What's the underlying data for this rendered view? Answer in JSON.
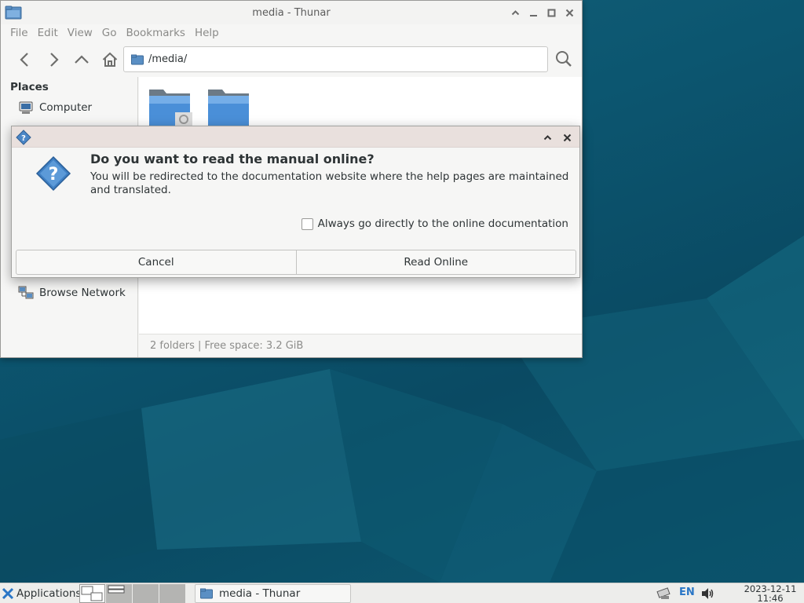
{
  "window": {
    "title": "media - Thunar",
    "menu": [
      "File",
      "Edit",
      "View",
      "Go",
      "Bookmarks",
      "Help"
    ],
    "location": "/media/",
    "sidebar": {
      "heading": "Places",
      "items": [
        {
          "label": "Computer",
          "icon": "computer-icon"
        },
        {
          "label": "Browse Network",
          "icon": "network-icon"
        }
      ]
    },
    "status": "2 folders  |  Free space: 3.2 GiB"
  },
  "dialog": {
    "heading": "Do you want to read the manual online?",
    "body": "You will be redirected to the documentation website where the help pages are maintained and translated.",
    "checkbox_label": "Always go directly to the online documentation",
    "checkbox_checked": false,
    "cancel_label": "Cancel",
    "read_online_label": "Read Online"
  },
  "panel": {
    "applications_label": "Applications",
    "task_label": "media - Thunar",
    "language": "EN",
    "date": "2023-12-11",
    "time": "11:46"
  },
  "colors": {
    "accent": "#2a76c6",
    "folder": "#4a8fd8",
    "desktop": "#0d4d63"
  }
}
